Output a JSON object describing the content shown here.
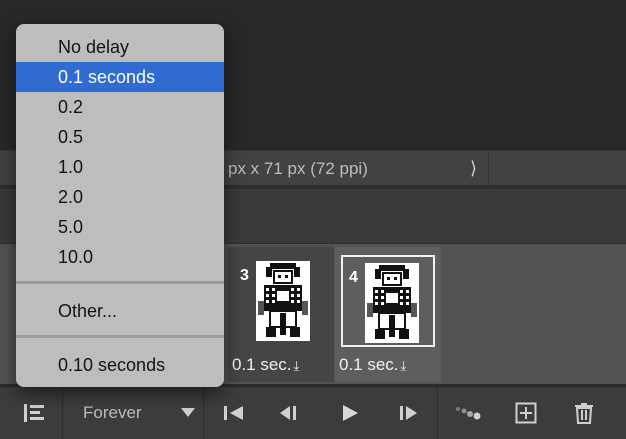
{
  "status_bar": {
    "info": "px x 71 px (72 ppi)",
    "expand_icon": "chevron-right-icon"
  },
  "delay_menu": {
    "options": [
      "No delay",
      "0.1 seconds",
      "0.2",
      "0.5",
      "1.0",
      "2.0",
      "5.0",
      "10.0"
    ],
    "selected": "0.1 seconds",
    "other": "Other...",
    "current": "0.10 seconds"
  },
  "frames": [
    {
      "number": "3",
      "delay": "0.1 sec.",
      "selected": false
    },
    {
      "number": "4",
      "delay": "0.1 sec.",
      "selected": true
    }
  ],
  "toolbar": {
    "loop_value": "Forever",
    "icons": [
      "convert-timeline-icon",
      "dropdown-triangle-icon",
      "first-frame-icon",
      "previous-frame-icon",
      "play-icon",
      "next-frame-icon",
      "tween-icon",
      "new-frame-icon",
      "delete-frame-icon"
    ]
  },
  "colors": {
    "selection": "#2f6bd0",
    "menu_bg": "#bdbdbd",
    "panel_bg": "#535353"
  }
}
